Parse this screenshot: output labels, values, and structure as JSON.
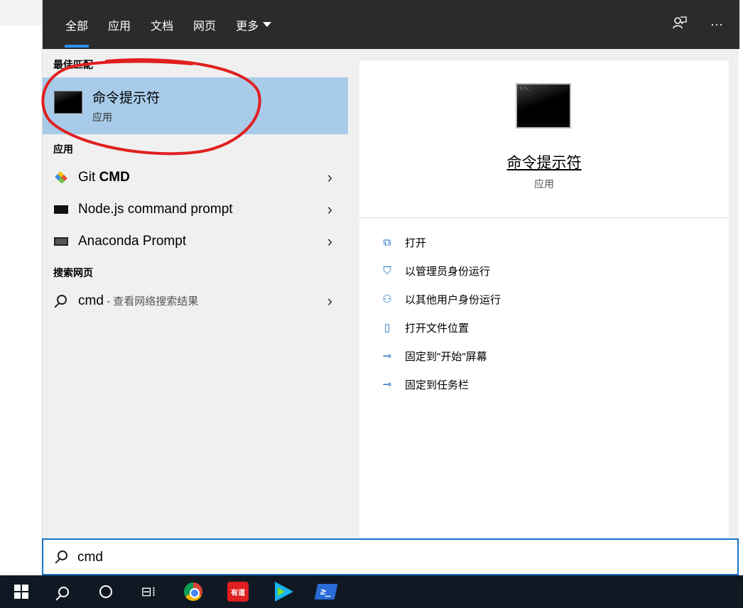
{
  "header": {
    "tabs": [
      {
        "label": "全部",
        "active": true
      },
      {
        "label": "应用",
        "active": false
      },
      {
        "label": "文档",
        "active": false
      },
      {
        "label": "网页",
        "active": false
      },
      {
        "label": "更多",
        "active": false
      }
    ],
    "feedback_icon": "feedback-icon",
    "more_icon": "more-options-icon",
    "more_glyph": "···"
  },
  "results": {
    "best_match_title": "最佳匹配",
    "best_match": {
      "name": "命令提示符",
      "kind": "应用"
    },
    "apps_title": "应用",
    "apps": [
      {
        "prefix": "Git ",
        "bold": "CMD",
        "icon": "git-icon"
      },
      {
        "prefix": "Node.js command prompt",
        "bold": "",
        "icon": "nodejs-icon"
      },
      {
        "prefix": "Anaconda Prompt",
        "bold": "",
        "icon": "anaconda-icon"
      }
    ],
    "web_title": "搜索网页",
    "web": {
      "query": "cmd",
      "suffix": " - 查看网络搜索结果"
    },
    "chevron": "›"
  },
  "preview": {
    "title": "命令提示符",
    "kind": "应用",
    "icon_caption": "C:\\_",
    "actions": [
      {
        "label": "打开",
        "icon": "open-icon",
        "glyph": "⧉"
      },
      {
        "label": "以管理员身份运行",
        "icon": "run-as-admin-icon",
        "glyph": "⛉"
      },
      {
        "label": "以其他用户身份运行",
        "icon": "run-as-other-user-icon",
        "glyph": "⚇"
      },
      {
        "label": "打开文件位置",
        "icon": "file-location-icon",
        "glyph": "▯"
      },
      {
        "label": "固定到\"开始\"屏幕",
        "icon": "pin-start-icon",
        "glyph": "⊸"
      },
      {
        "label": "固定到任务栏",
        "icon": "pin-taskbar-icon",
        "glyph": "⊸"
      }
    ]
  },
  "search": {
    "value": "cmd"
  },
  "taskbar": {
    "items": [
      "start-icon",
      "search-icon",
      "cortana-icon",
      "task-view-icon",
      "chrome-icon",
      "youdao-icon",
      "video-player-icon",
      "powershell-icon"
    ],
    "youdao_label": "有道",
    "task_view_glyph": "⊟⁞",
    "powershell_glyph": "≥_"
  },
  "colors": {
    "header_bg": "#2b2b2b",
    "accent": "#2f8ff0",
    "selected_row": "#a8cbe9",
    "annotation": "#e02020",
    "taskbar_bg": "#101923"
  }
}
